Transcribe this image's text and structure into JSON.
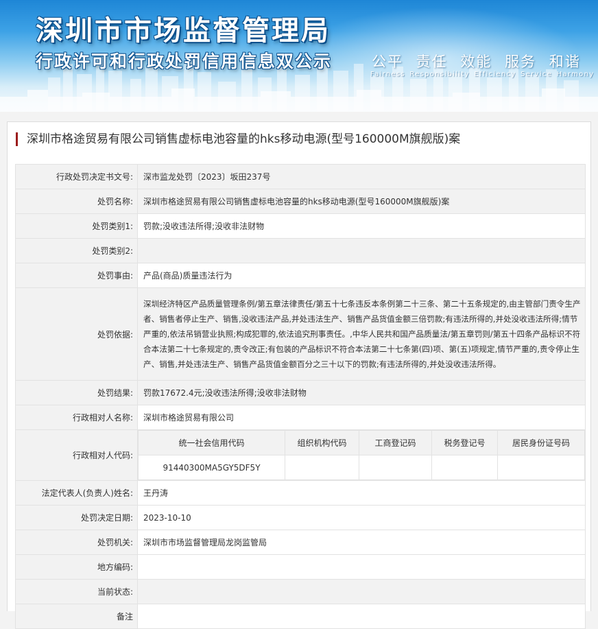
{
  "banner": {
    "title": "深圳市市场监督管理局",
    "subtitle": "行政许可和行政处罚信用信息双公示",
    "slogan": "公平 责任 效能 服务 和谐",
    "slogan_en": "Fairness Responsibility Efficiency Service Harmony"
  },
  "case": {
    "title": "深圳市格途贸易有限公司销售虚标电池容量的hks移动电源(型号160000M旗舰版)案",
    "rows": {
      "doc_no": {
        "label": "行政处罚决定书文号:",
        "value": "深市监龙处罚〔2023〕坂田237号"
      },
      "name": {
        "label": "处罚名称:",
        "value": "深圳市格途贸易有限公司销售虚标电池容量的hks移动电源(型号160000M旗舰版)案"
      },
      "type1": {
        "label": "处罚类别1:",
        "value": "罚款;没收违法所得;没收非法财物"
      },
      "type2": {
        "label": "处罚类别2:",
        "value": ""
      },
      "reason": {
        "label": "处罚事由:",
        "value": "产品(商品)质量违法行为"
      },
      "basis": {
        "label": "处罚依据:",
        "value": "深圳经济特区产品质量管理条例/第五章法律责任/第五十七条违反本条例第二十三条、第二十五条规定的,由主管部门责令生产者、销售者停止生产、销售,没收违法产品,并处违法生产、销售产品货值金额三倍罚款;有违法所得的,并处没收违法所得;情节严重的,依法吊销营业执照;构成犯罪的,依法追究刑事责任。,中华人民共和国产品质量法/第五章罚则/第五十四条产品标识不符合本法第二十七条规定的,责令改正;有包装的产品标识不符合本法第二十七条第(四)项、第(五)项规定,情节严重的,责令停止生产、销售,并处违法生产、销售产品货值金额百分之三十以下的罚款;有违法所得的,并处没收违法所得。"
      },
      "result": {
        "label": "处罚结果:",
        "value": "罚款17672.4元;没收违法所得;没收非法财物"
      },
      "party_name": {
        "label": "行政相对人名称:",
        "value": "深圳市格途贸易有限公司"
      },
      "party_code": {
        "label": "行政相对人代码:",
        "headers": [
          "统一社会信用代码",
          "组织机构代码",
          "工商登记码",
          "税务登记号",
          "居民身份证号码"
        ],
        "values": [
          "91440300MA5GY5DF5Y",
          "",
          "",
          "",
          ""
        ]
      },
      "legal_rep": {
        "label": "法定代表人(负责人)姓名:",
        "value": "王丹涛"
      },
      "date": {
        "label": "处罚决定日期:",
        "value": "2023-10-10"
      },
      "authority": {
        "label": "处罚机关:",
        "value": "深圳市市场监督管理局龙岗监管局"
      },
      "local_code": {
        "label": "地方编码:",
        "value": ""
      },
      "status": {
        "label": "当前状态:",
        "value": ""
      },
      "remark": {
        "label": "备注",
        "value": ""
      }
    }
  }
}
